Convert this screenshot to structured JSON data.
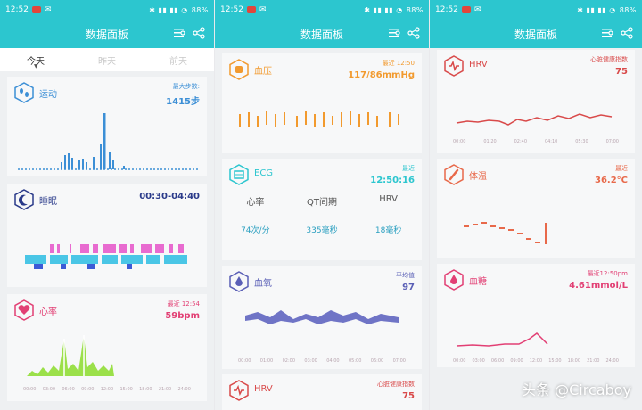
{
  "status": {
    "time": "12:52",
    "battery": "88%"
  },
  "header": {
    "title": "数据面板"
  },
  "tabs": [
    {
      "label": "今天"
    },
    {
      "label": "昨天"
    },
    {
      "label": "前天"
    }
  ],
  "screen1": {
    "sport": {
      "title": "运动",
      "stat_label": "最大步数:",
      "stat_value": "1415步"
    },
    "sleep": {
      "title": "睡眠",
      "stat_value": "00:30-04:40"
    },
    "heart": {
      "title": "心率",
      "stat_label": "最近 12:54",
      "stat_value": "59bpm",
      "ticks": [
        "00:00",
        "03:00",
        "06:00",
        "09:00",
        "12:00",
        "15:00",
        "18:00",
        "21:00",
        "24:00"
      ]
    }
  },
  "screen2": {
    "bp": {
      "title": "血压",
      "stat_label": "最近 12:50",
      "stat_value": "117/86mmHg"
    },
    "ecg": {
      "title": "ECG",
      "stat_label": "最近",
      "stat_value": "12:50:16",
      "headers": [
        "心率",
        "QT间期",
        "HRV"
      ],
      "values": [
        "74次/分",
        "335毫秒",
        "18毫秒"
      ]
    },
    "spo2": {
      "title": "血氧",
      "stat_label": "平均值",
      "stat_value": "97",
      "ticks": [
        "00:00",
        "01:00",
        "02:00",
        "03:00",
        "04:00",
        "05:00",
        "06:00",
        "07:00"
      ]
    },
    "hrv": {
      "title": "HRV",
      "stat_label": "心脏健康指数",
      "stat_value": "75"
    }
  },
  "screen3": {
    "hrv": {
      "title": "HRV",
      "stat_label": "心脏健康指数",
      "stat_value": "75",
      "ticks": [
        "00:00",
        "01:20",
        "02:40",
        "04:10",
        "05:30",
        "07:00"
      ]
    },
    "temp": {
      "title": "体温",
      "stat_label": "最近",
      "stat_value": "36.2°C"
    },
    "glucose": {
      "title": "血糖",
      "stat_label": "最近12:50pm",
      "stat_value": "4.61mmol/L",
      "ticks": [
        "00:00",
        "03:00",
        "06:00",
        "09:00",
        "12:00",
        "15:00",
        "18:00",
        "21:00",
        "24:00"
      ]
    }
  },
  "watermark": "头条 @Circaboy",
  "colors": {
    "header": "#2cc6cf",
    "sport": "#3c8fd6",
    "sleep": "#2a3a8a",
    "heart": "#e23f74",
    "bp": "#f29a2e",
    "ecg": "#2cc6cf",
    "spo2": "#5a5fb6",
    "hrv": "#d94a4a"
  }
}
